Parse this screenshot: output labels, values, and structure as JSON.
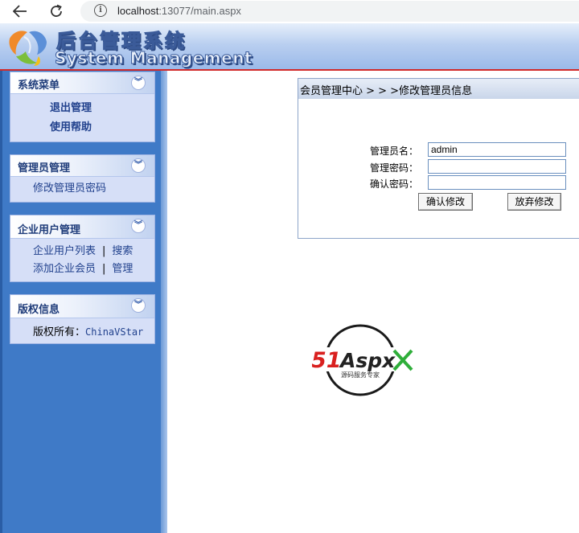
{
  "browser": {
    "url_host": "localhost",
    "url_rest": ":13077/main.aspx"
  },
  "header": {
    "title_cn": "后台管理系统",
    "title_en": "System Management"
  },
  "sidebar": {
    "panels": [
      {
        "title": "系统菜单",
        "items": [
          "退出管理",
          "使用帮助"
        ]
      },
      {
        "title": "管理员管理",
        "items": [
          "修改管理员密码"
        ]
      },
      {
        "title": "企业用户管理",
        "rows": [
          [
            "企业用户列表",
            "搜索"
          ],
          [
            "添加企业会员",
            "管理"
          ]
        ]
      },
      {
        "title": "版权信息",
        "copyright_label": "版权所有：",
        "copyright_value": "ChinaVStar"
      }
    ],
    "separator": "|"
  },
  "main": {
    "breadcrumb": "会员管理中心 > > >修改管理员信息",
    "form": {
      "username_label": "管理员名：",
      "username_value": "admin",
      "password_label": "管理密码：",
      "password_value": "",
      "confirm_label": "确认密码：",
      "confirm_value": "",
      "confirm_button": "确认修改",
      "cancel_button": "放弃修改"
    },
    "badge": {
      "brand": "51Aspx",
      "tagline": "源码服务专家"
    }
  },
  "colors": {
    "sidebar_bg": "#3f7ac7",
    "panel_bg": "#d6dff7",
    "link": "#21418d",
    "header_accent": "#d22a2a"
  }
}
